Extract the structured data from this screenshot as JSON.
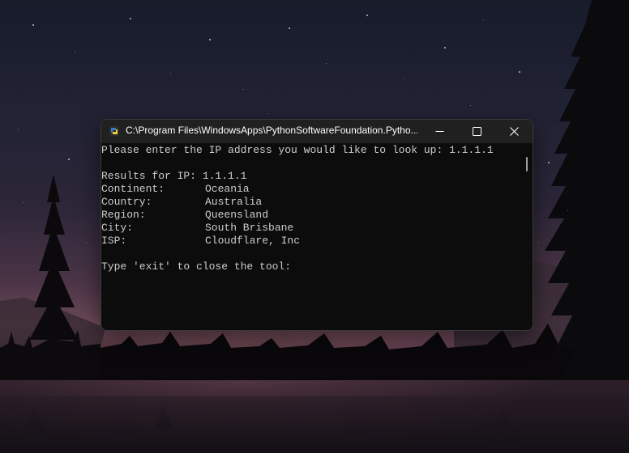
{
  "window": {
    "title": "C:\\Program Files\\WindowsApps\\PythonSoftwareFoundation.Pytho...",
    "minimize_icon": "minimize-icon",
    "maximize_icon": "maximize-icon",
    "close_icon": "close-icon",
    "app_icon": "python-icon"
  },
  "console": {
    "prompt": "Please enter the IP address you would like to look up: 1.1.1.1",
    "results_header": "Results for IP: 1.1.1.1",
    "fields": [
      {
        "label": "Continent:",
        "value": "Oceania"
      },
      {
        "label": "Country:",
        "value": "Australia"
      },
      {
        "label": "Region:",
        "value": "Queensland"
      },
      {
        "label": "City:",
        "value": "South Brisbane"
      },
      {
        "label": "ISP:",
        "value": "Cloudflare, Inc"
      }
    ],
    "exit_prompt": "Type 'exit' to close the tool:"
  },
  "colors": {
    "console_bg": "#0c0c0c",
    "console_text": "#cccccc",
    "titlebar_bg": "#202020"
  }
}
